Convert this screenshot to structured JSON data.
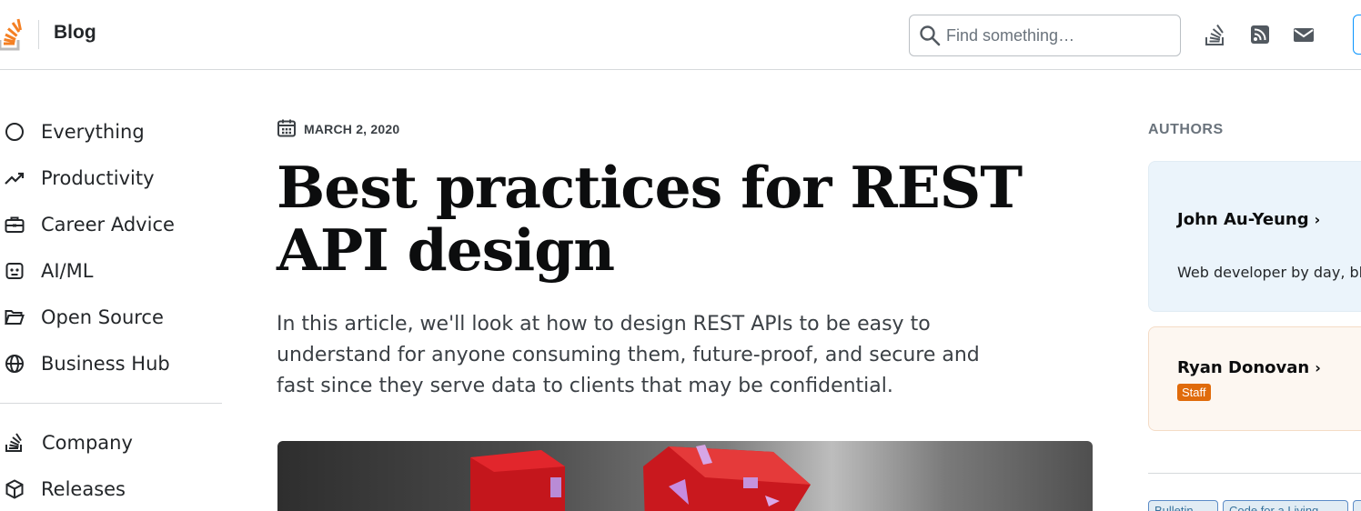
{
  "header": {
    "blog_label": "Blog",
    "search_placeholder": "Find something…"
  },
  "icons": {
    "logo": "stack-overflow-logo",
    "search": "search-icon",
    "stackoverflow": "stackoverflow-icon",
    "rss": "rss-icon",
    "mail": "mail-icon"
  },
  "nav": {
    "items": [
      {
        "label": "Everything",
        "icon": "circle-icon"
      },
      {
        "label": "Productivity",
        "icon": "trending-up-icon"
      },
      {
        "label": "Career Advice",
        "icon": "briefcase-icon"
      },
      {
        "label": "AI/ML",
        "icon": "robot-icon"
      },
      {
        "label": "Open Source",
        "icon": "folder-open-icon"
      },
      {
        "label": "Business Hub",
        "icon": "globe-icon"
      }
    ],
    "secondary": [
      {
        "label": "Company",
        "icon": "stackoverflow-icon"
      },
      {
        "label": "Releases",
        "icon": "cube-icon"
      }
    ]
  },
  "article": {
    "date": "MARCH 2, 2020",
    "title": "Best practices for REST API design",
    "lede": "In this article, we'll look at how to design REST APIs to be easy to understand for anyone consuming them, future-proof, and secure and fast since they serve data to clients that may be confidential."
  },
  "sidebar": {
    "authors_heading": "AUTHORS",
    "authors": [
      {
        "name": "John Au-Yeung",
        "bio": "Web developer by day, blo"
      },
      {
        "name": "Ryan Donovan",
        "badge": "Staff"
      }
    ],
    "tags": [
      "Bulletin",
      "Code for a Living",
      ""
    ]
  },
  "colors": {
    "brand_orange": "#f48024",
    "staff_badge": "#e06b0b",
    "link_blue": "#0a95ff"
  }
}
